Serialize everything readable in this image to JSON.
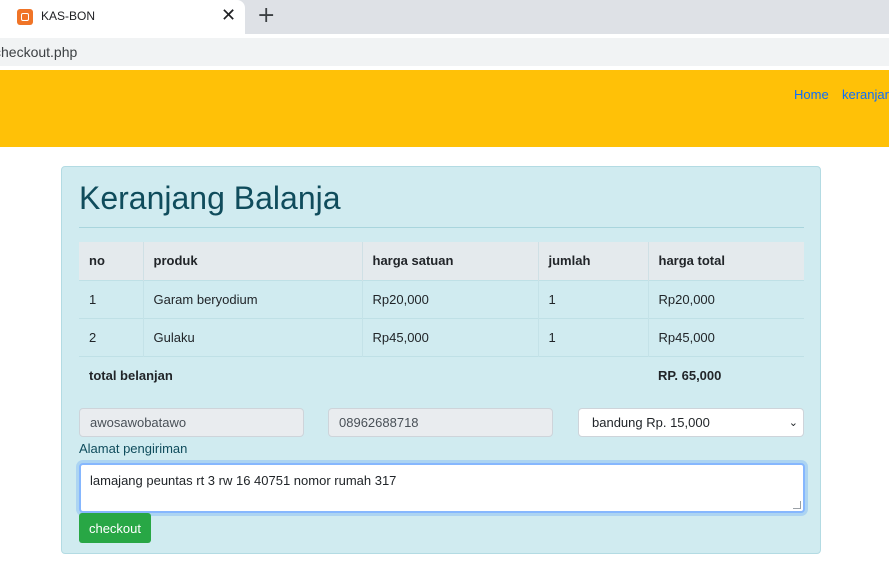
{
  "browser": {
    "tab_title": "KAS-BON",
    "close_symbol": "✕",
    "new_tab_symbol": "+",
    "url": "checkout.php"
  },
  "navbar": {
    "links": [
      "Home",
      "keranjang"
    ]
  },
  "cart": {
    "title": "Keranjang Balanja",
    "columns": [
      "no",
      "produk",
      "harga satuan",
      "jumlah",
      "harga total"
    ],
    "rows": [
      [
        "1",
        "Garam beryodium",
        "Rp20,000",
        "1",
        "Rp20,000"
      ],
      [
        "2",
        "Gulaku",
        "Rp45,000",
        "1",
        "Rp45,000"
      ]
    ],
    "total_label": "total belanjan",
    "total_value": "RP. 65,000"
  },
  "form": {
    "name_value": "awosawobatawo",
    "phone_value": "08962688718",
    "shipping_selected": "bandung Rp. 15,000",
    "caret_symbol": "⌄",
    "address_label": "Alamat pengiriman",
    "address_value": "lamajang peuntas rt 3 rw 16 40751 nomor rumah 317",
    "checkout_label": "checkout"
  },
  "colors": {
    "navbar": "#ffc107",
    "card": "#d0ebf0",
    "title": "#0f4c5c",
    "button": "#28a745",
    "link": "#0d6efd"
  }
}
